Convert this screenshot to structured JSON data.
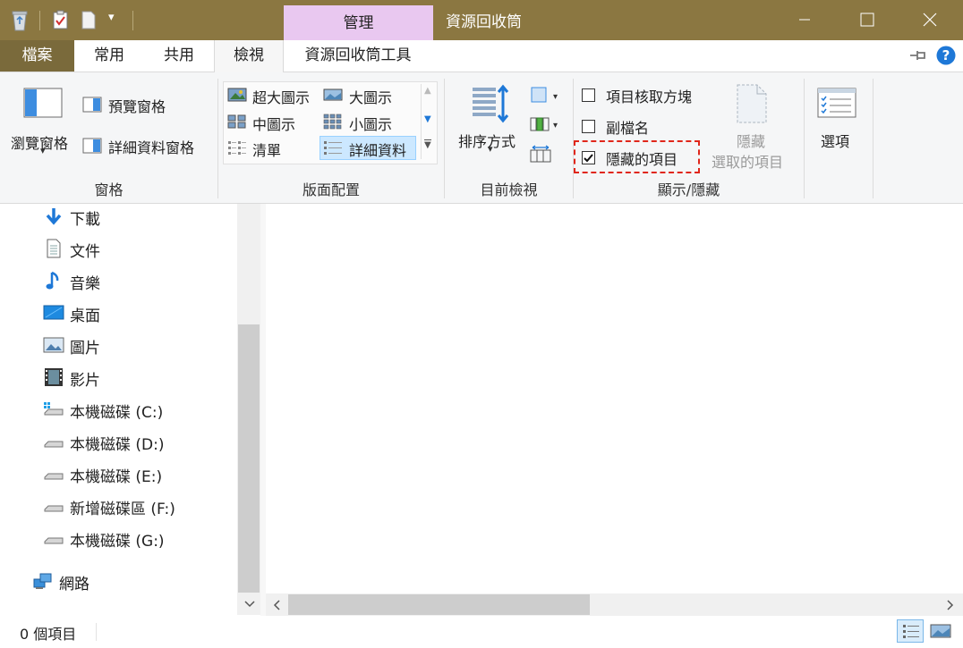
{
  "window": {
    "title": "資源回收筒",
    "context_tab": "管理"
  },
  "tabs": {
    "file": "檔案",
    "home": "常用",
    "share": "共用",
    "view": "檢視",
    "recycle_tools": "資源回收筒工具"
  },
  "ribbon": {
    "panes": {
      "navigation_pane": "瀏覽窗格",
      "preview_pane": "預覽窗格",
      "details_pane": "詳細資料窗格",
      "group_label": "窗格"
    },
    "layout": {
      "extra_large": "超大圖示",
      "large": "大圖示",
      "medium": "中圖示",
      "small": "小圖示",
      "list": "清單",
      "details": "詳細資料",
      "group_label": "版面配置"
    },
    "current_view": {
      "sort_by": "排序方式",
      "group_label": "目前檢視"
    },
    "show_hide": {
      "item_checkboxes": "項目核取方塊",
      "file_extensions": "副檔名",
      "hidden_items": "隱藏的項目",
      "item_checkboxes_checked": false,
      "file_extensions_checked": false,
      "hidden_items_checked": true,
      "hide_selected_line1": "隱藏",
      "hide_selected_line2": "選取的項目",
      "group_label": "顯示/隱藏"
    },
    "options": "選項"
  },
  "nav": {
    "items": [
      {
        "label": "下載",
        "icon": "download-icon"
      },
      {
        "label": "文件",
        "icon": "document-icon"
      },
      {
        "label": "音樂",
        "icon": "music-icon"
      },
      {
        "label": "桌面",
        "icon": "desktop-icon"
      },
      {
        "label": "圖片",
        "icon": "pictures-icon"
      },
      {
        "label": "影片",
        "icon": "videos-icon"
      },
      {
        "label": "本機磁碟 (C:)",
        "icon": "system-drive-icon"
      },
      {
        "label": "本機磁碟 (D:)",
        "icon": "drive-icon"
      },
      {
        "label": "本機磁碟 (E:)",
        "icon": "drive-icon"
      },
      {
        "label": "新增磁碟區 (F:)",
        "icon": "drive-icon"
      },
      {
        "label": "本機磁碟 (G:)",
        "icon": "drive-icon"
      }
    ],
    "network": "網路"
  },
  "status": {
    "item_count": "0 個項目"
  },
  "colors": {
    "titlebar": "#8b7741",
    "context_tab": "#e9c8f0",
    "highlight_border": "#e0261a",
    "accent_blue": "#1e78d7"
  }
}
